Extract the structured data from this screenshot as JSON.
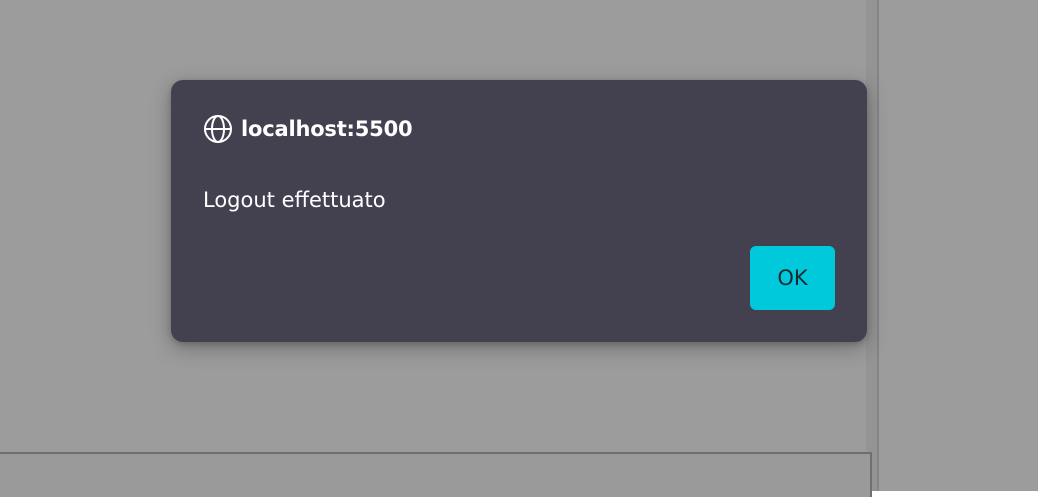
{
  "dialog": {
    "origin": "localhost:5500",
    "origin_icon": "globe-icon",
    "message": "Logout effettuato",
    "ok_label": "OK"
  },
  "colors": {
    "backdrop": "#9c9c9d",
    "dialog_background": "#434150",
    "accent": "#00c9dc",
    "text": "#ffffff"
  }
}
